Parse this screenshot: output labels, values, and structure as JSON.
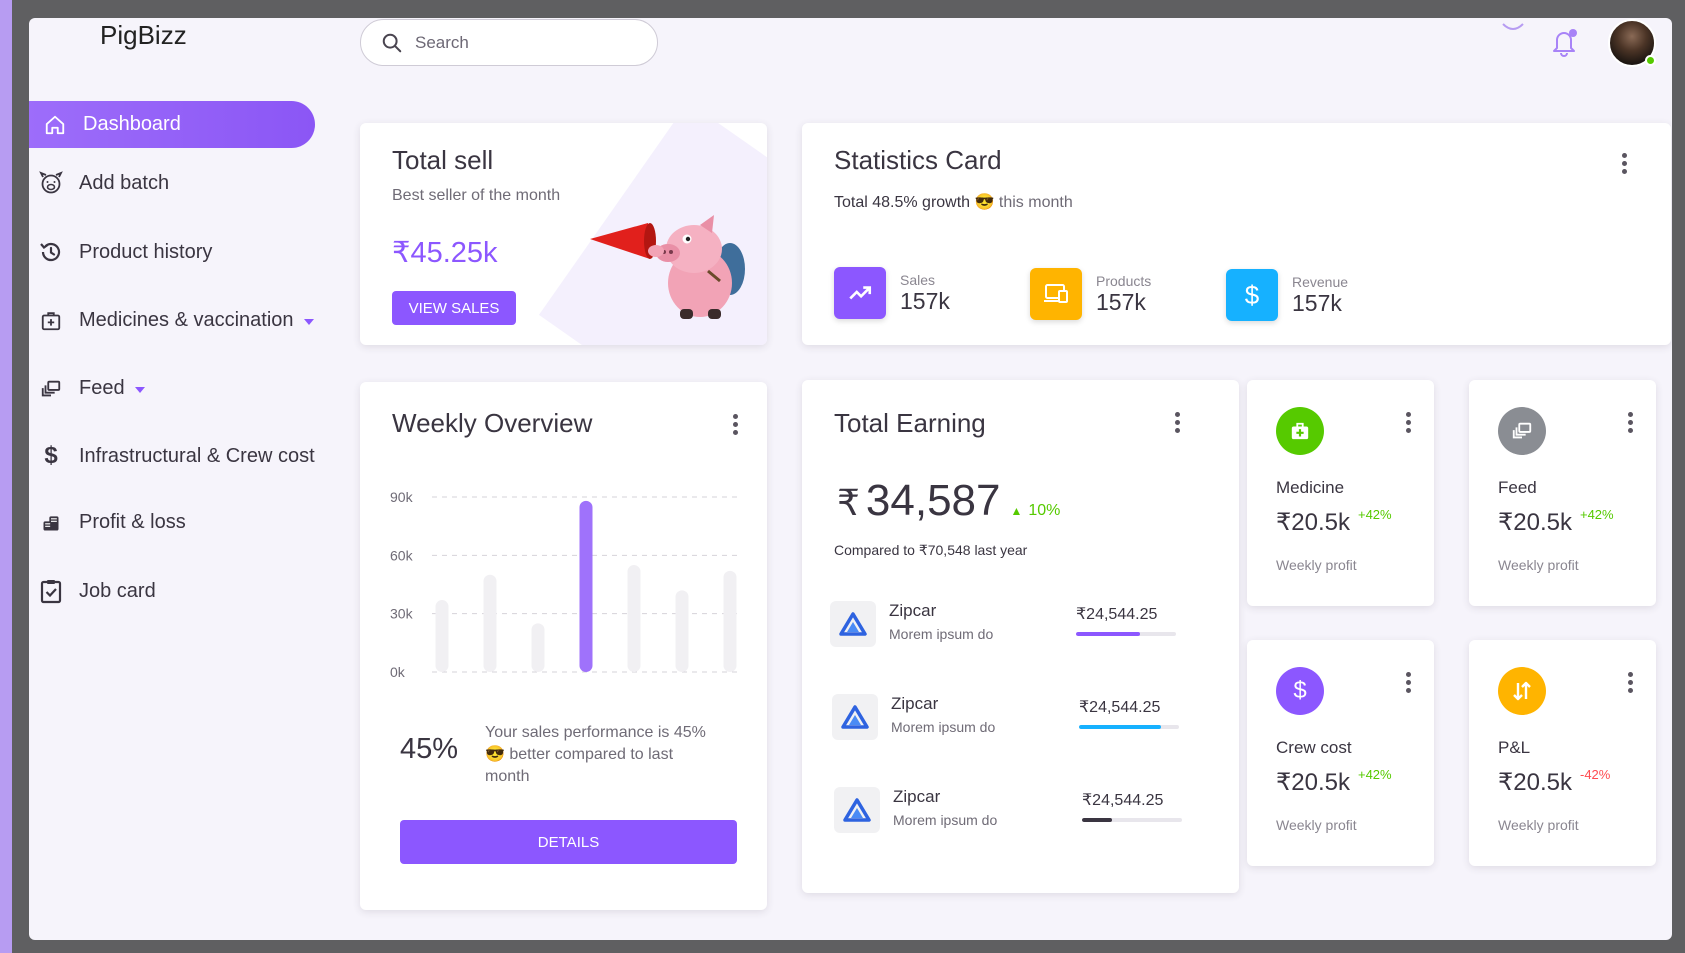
{
  "app": {
    "brand": "PigBizz"
  },
  "search": {
    "placeholder": "Search"
  },
  "sidebar": {
    "items": [
      {
        "label": "Dashboard",
        "icon": "home-icon",
        "active": true
      },
      {
        "label": "Add batch",
        "icon": "pig-icon"
      },
      {
        "label": "Product history",
        "icon": "history-icon"
      },
      {
        "label": "Medicines & vaccination",
        "icon": "medical-bag-icon",
        "dropdown": true
      },
      {
        "label": "Feed",
        "icon": "feed-icon",
        "dropdown": true
      },
      {
        "label": "Infrastructural & Crew cost",
        "icon": "dollar-icon"
      },
      {
        "label": "Profit & loss",
        "icon": "coins-icon"
      },
      {
        "label": "Job card",
        "icon": "clipboard-check-icon"
      }
    ]
  },
  "total_sell": {
    "title": "Total sell",
    "subtitle": "Best seller of the month",
    "value": "₹45.25k",
    "button": "VIEW SALES"
  },
  "statistics": {
    "title": "Statistics Card",
    "growth_prefix": "Total 48.5% growth",
    "growth_emoji": "😎",
    "growth_suffix": "this month",
    "items": [
      {
        "label": "Sales",
        "value": "157k",
        "color": "#8c57ff",
        "icon": "trending-up-icon"
      },
      {
        "label": "Products",
        "value": "157k",
        "color": "#ffb400",
        "icon": "devices-icon"
      },
      {
        "label": "Revenue",
        "value": "157k",
        "color": "#16b1ff",
        "icon": "dollar-icon"
      }
    ]
  },
  "weekly": {
    "title": "Weekly Overview",
    "percent": "45%",
    "desc_line1": "Your sales performance is 45%",
    "desc_emoji": "😎",
    "desc_line2": "better compared to last",
    "desc_line3": "month",
    "button": "DETAILS"
  },
  "chart_data": {
    "type": "bar",
    "categories": [
      "",
      "",
      "",
      "",
      "",
      "",
      ""
    ],
    "values": [
      37,
      50,
      25,
      88,
      55,
      42,
      52
    ],
    "ylim": [
      0,
      90
    ],
    "yticks": [
      0,
      30,
      60,
      90
    ],
    "ytick_labels": [
      "0k",
      "30k",
      "60k",
      "90k"
    ],
    "highlight_index": 3,
    "colors": {
      "bar": "#f1f0f3",
      "highlight": "#9f72fb",
      "grid": "#d6d3da"
    },
    "grid": true
  },
  "earning": {
    "title": "Total Earning",
    "currency": "₹",
    "amount": "34,587",
    "change": "10%",
    "compare": "Compared to ₹70,548 last year",
    "rows": [
      {
        "name": "Zipcar",
        "sub": "Morem ipsum do",
        "value": "₹24,544.25",
        "progress": 0.64,
        "color": "#8c57ff"
      },
      {
        "name": "Zipcar",
        "sub": "Morem ipsum do",
        "value": "₹24,544.25",
        "progress": 0.82,
        "color": "#16b1ff"
      },
      {
        "name": "Zipcar",
        "sub": "Morem ipsum do",
        "value": "₹24,544.25",
        "progress": 0.3,
        "color": "#3a3541"
      }
    ]
  },
  "mini_cards": [
    {
      "title": "Medicine",
      "value": "₹20.5k",
      "change": "+42%",
      "sub": "Weekly profit",
      "color": "#56ca00",
      "icon": "medical-bag-icon",
      "positive": true
    },
    {
      "title": "Feed",
      "value": "₹20.5k",
      "change": "+42%",
      "sub": "Weekly profit",
      "color": "#8a8d93",
      "icon": "feed-icon",
      "positive": true
    },
    {
      "title": "Crew cost",
      "value": "₹20.5k",
      "change": "+42%",
      "sub": "Weekly profit",
      "color": "#8c57ff",
      "icon": "dollar-icon",
      "positive": true
    },
    {
      "title": "P&L",
      "value": "₹20.5k",
      "change": "-42%",
      "sub": "Weekly profit",
      "color": "#ffb400",
      "icon": "swap-vertical-icon",
      "positive": false
    }
  ]
}
